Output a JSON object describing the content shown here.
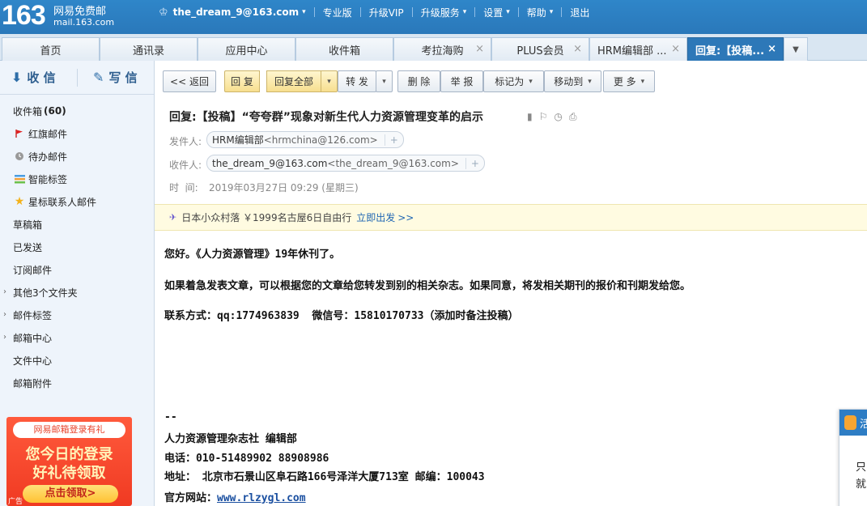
{
  "header": {
    "logo_num": "163",
    "brand": "网易免费邮",
    "domain": "mail.163.com",
    "user": "the_dream_9@163.com",
    "nav": [
      "专业版",
      "升级VIP",
      "升级服务",
      "设置",
      "帮助",
      "退出"
    ]
  },
  "tabs": [
    {
      "label": "首页"
    },
    {
      "label": "通讯录"
    },
    {
      "label": "应用中心"
    },
    {
      "label": "收件箱"
    },
    {
      "label": "考拉海购"
    },
    {
      "label": "PLUS会员"
    },
    {
      "label": "HRM编辑部 ..."
    },
    {
      "label": "回复:【投稿..."
    }
  ],
  "sidebar": {
    "receive": "收 信",
    "compose": "写 信",
    "folders": [
      {
        "label": "收件箱",
        "count": "(60)"
      },
      {
        "label": "红旗邮件"
      },
      {
        "label": "待办邮件"
      },
      {
        "label": "智能标签"
      },
      {
        "label": "星标联系人邮件"
      },
      {
        "label": "草稿箱"
      },
      {
        "label": "已发送"
      },
      {
        "label": "订阅邮件"
      },
      {
        "label": "其他3个文件夹"
      },
      {
        "label": "邮件标签"
      },
      {
        "label": "邮箱中心"
      },
      {
        "label": "文件中心"
      },
      {
        "label": "邮箱附件"
      }
    ],
    "ad": {
      "ribbon": "网易邮箱登录有礼",
      "line1": "您今日的登录",
      "line2": "好礼待领取",
      "button": "点击领取>",
      "tag": "广告"
    }
  },
  "toolbar": {
    "back": "<< 返回",
    "reply": "回 复",
    "reply_all": "回复全部",
    "forward": "转 发",
    "delete": "删 除",
    "report": "举 报",
    "mark_as": "标记为",
    "move_to": "移动到",
    "more": "更 多"
  },
  "message": {
    "subject": "回复:【投稿】“夸夸群”现象对新生代人力资源管理变革的启示",
    "from_label": "发件人:",
    "from_name": "HRM编辑部",
    "from_email": "<hrmchina@126.com>",
    "to_label": "收件人:",
    "to_name": "the_dream_9@163.com",
    "to_email": "<the_dream_9@163.com>",
    "time_label": "时  间:",
    "time_value": "2019年03月27日 09:29 (星期三)",
    "promo_text": "日本小众村落 ￥1999名古屋6日自由行",
    "promo_link": "立即出发",
    "promo_arrow": ">>",
    "body": [
      "您好。《人力资源管理》19年休刊了。",
      "如果着急发表文章，可以根据您的文章给您转发到别的相关杂志。如果同意，将发相关期刊的报价和刊期发给您。",
      "联系方式：qq:1774963839  微信号：15810170733（添加时备注投稿）"
    ],
    "signature": {
      "dash": "--",
      "org": "人力资源管理杂志社 编辑部",
      "phone": "电话：010-51489902 88908986",
      "address": "地址： 北京市石景山区阜石路166号泽洋大厦713室 邮编：100043",
      "website_label": "官方网站：",
      "website": "www.rlzygl.com"
    }
  },
  "float_widget": {
    "head_char": "活",
    "line1": "只",
    "line2": "就"
  }
}
